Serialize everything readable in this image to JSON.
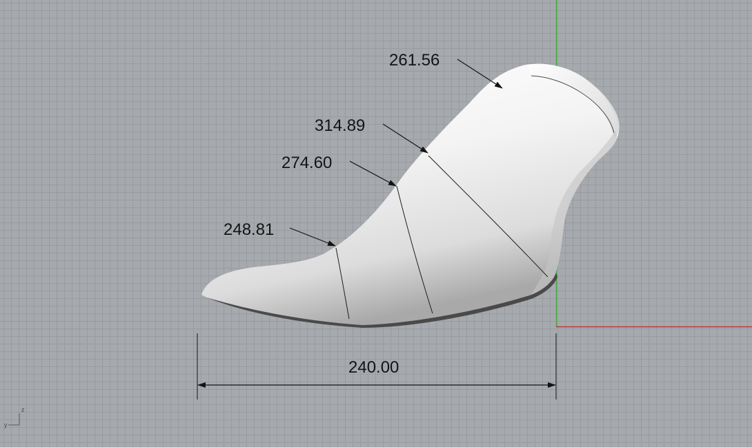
{
  "viewport": {
    "colors": {
      "background": "#a6a9ad",
      "grid": "#989ca0",
      "x_axis": "#c02828",
      "y_axis": "#2fa82f",
      "model": "#f2f2f2",
      "dimension": "#141414"
    }
  },
  "dimensions": {
    "length": "240.00",
    "girths": [
      "261.56",
      "314.89",
      "274.60",
      "248.81"
    ]
  },
  "axis_widget": {
    "z_label": "z",
    "y_label": "y"
  }
}
